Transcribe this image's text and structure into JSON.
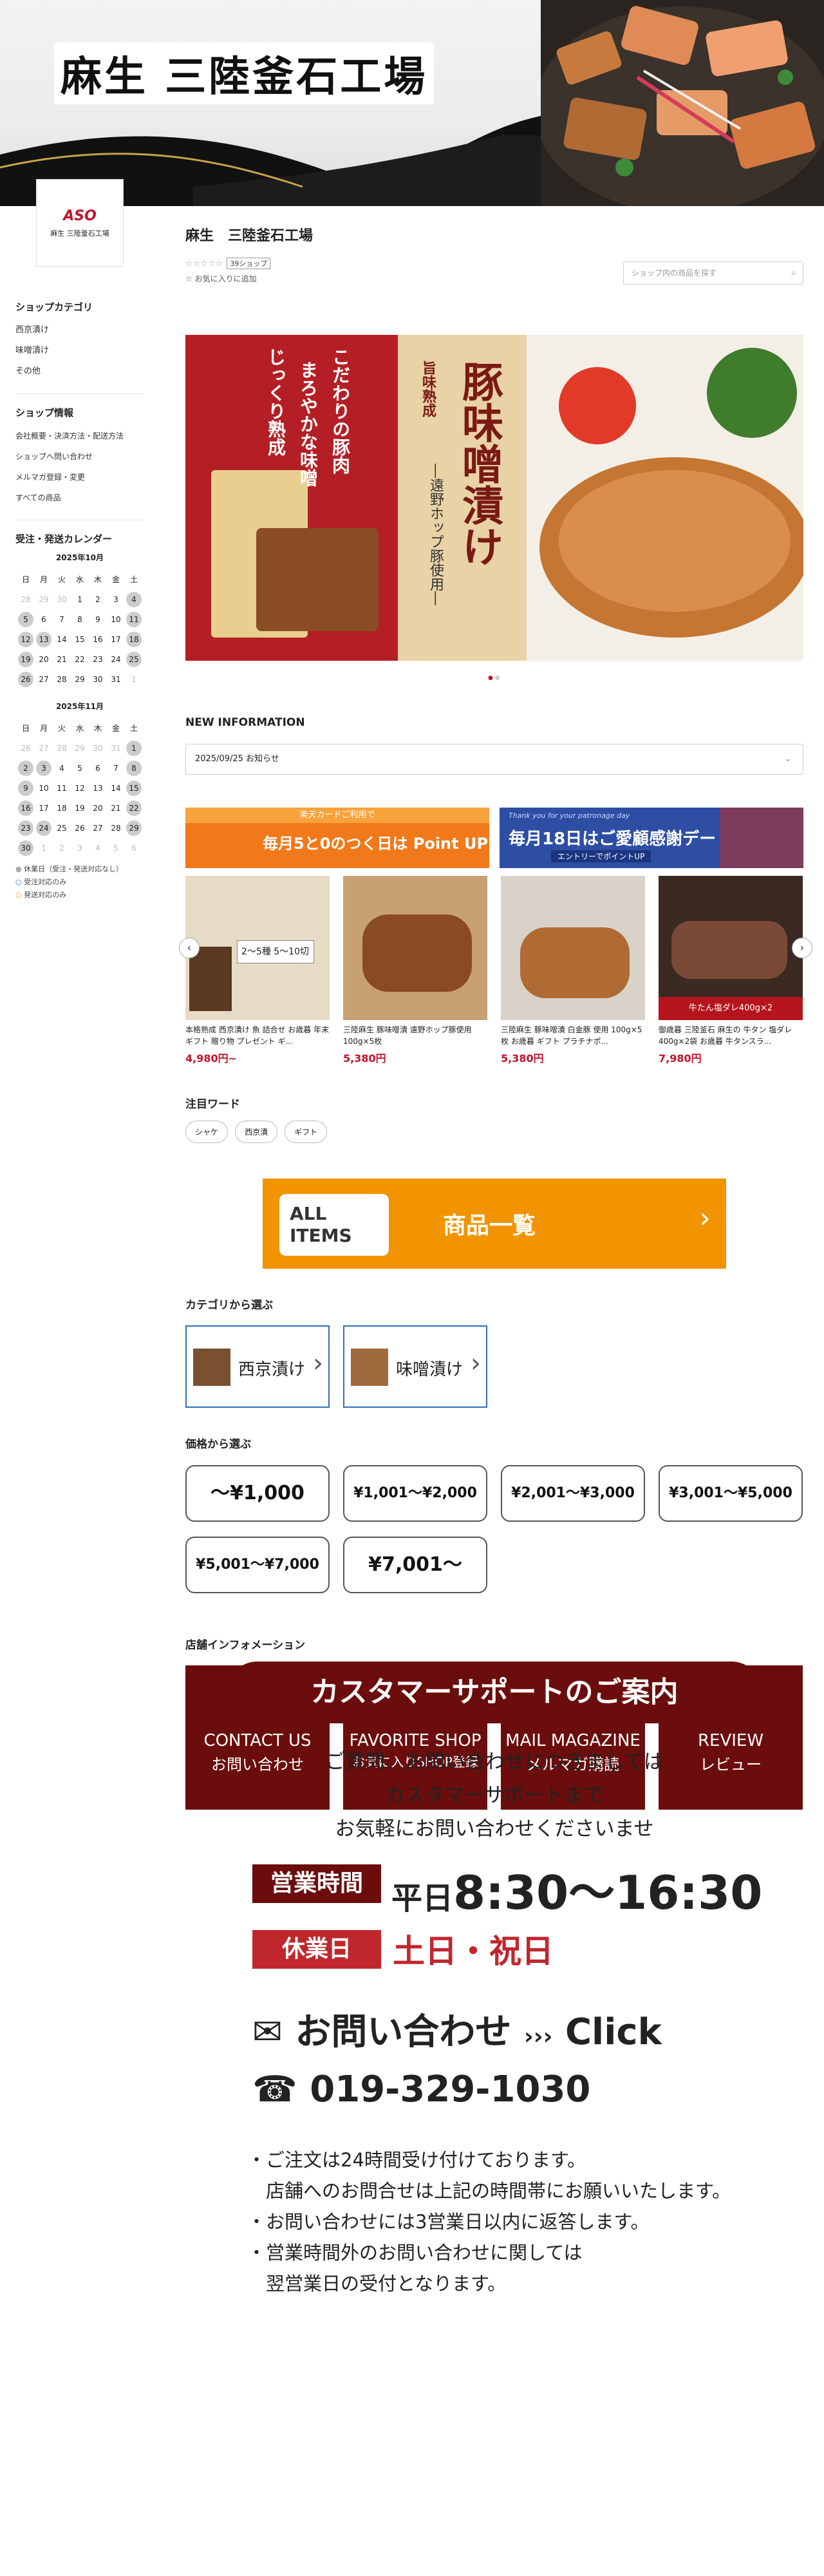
{
  "header": {
    "shop_title": "麻生 三陸釜石工場"
  },
  "logo": {
    "mark": "ASO",
    "name": "麻生 三陸釜石工場"
  },
  "sidebar": {
    "category_title": "ショップカテゴリ",
    "categories": [
      "西京漬け",
      "味噌漬け",
      "その他"
    ],
    "info_title": "ショップ情報",
    "info_links": [
      "会社概要・決済方法・配送方法",
      "ショップへ問い合わせ",
      "メルマガ登録・変更",
      "すべての商品"
    ],
    "calendar_title": "受注・発送カレンダー",
    "weekdays": [
      "日",
      "月",
      "火",
      "水",
      "木",
      "金",
      "土"
    ],
    "month1": "2025年10月",
    "month2": "2025年11月",
    "legend": [
      "休業日（受注・発送対応なし）",
      "受注対応のみ",
      "発送対応のみ"
    ]
  },
  "shop": {
    "name": "麻生　三陸釜石工場",
    "review_count": "39ショップ",
    "favorite": "お気に入りに追加",
    "search_placeholder": "ショップ内の商品を探す"
  },
  "banner": {
    "main": "豚味噌漬け",
    "sub": "旨味熟成",
    "tag": "―遠野ホップ豚使用―",
    "left1": "こだわりの豚肉",
    "left2": "まろやかな味噌",
    "left3": "じっくり熟成"
  },
  "news": {
    "title": "NEW INFORMATION",
    "item": "2025/09/25 お知らせ"
  },
  "promos": [
    {
      "top": "楽天カードご利用で",
      "main": "毎月5と0のつく日は Point UP"
    },
    {
      "top": "Thank you for your patronage day",
      "main": "毎月18日はご愛顧感謝デー",
      "sub": "エントリーでポイントUP"
    }
  ],
  "products": [
    {
      "title": "本格熟成 西京漬け 魚 詰合せ お歳暮 年末ギフト 贈り物 プレゼント ギ...",
      "price": "4,980円~",
      "badge": "2〜5種 5〜10切"
    },
    {
      "title": "三陸麻生 豚味噌漬 遠野ホップ豚使用 100g×5枚",
      "price": "5,380円"
    },
    {
      "title": "三陸麻生 豚味噌漬 白金豚 使用 100g×5枚 お歳暮 ギフト プラチナポ...",
      "price": "5,380円"
    },
    {
      "title": "御歳暮 三陸釜石 麻生の 牛タン 塩ダレ 400g×2袋 お歳暮 牛タンスラ...",
      "price": "7,980円",
      "badge": "牛たん塩ダレ400g×2"
    }
  ],
  "keywords": {
    "title": "注目ワード",
    "tags": [
      "シャケ",
      "西京漬",
      "ギフト"
    ]
  },
  "all_items": {
    "en1": "ALL",
    "en2": "ITEMS",
    "jp": "商品一覧"
  },
  "category_section": {
    "title": "カテゴリから選ぶ",
    "items": [
      "西京漬け",
      "味噌漬け"
    ]
  },
  "price_section": {
    "title": "価格から選ぶ",
    "items": [
      "〜¥1,000",
      "¥1,001〜¥2,000",
      "¥2,001〜¥3,000",
      "¥3,001〜¥5,000",
      "¥5,001〜¥7,000",
      "¥7,001〜"
    ]
  },
  "info_section": {
    "title": "店舗インフォメーション",
    "items": [
      {
        "en": "CONTACT US",
        "jp": "お問い合わせ",
        "icon": "chat-icon"
      },
      {
        "en": "FAVORITE SHOP",
        "jp": "お気に入りSHOP登録",
        "icon": "home-icon"
      },
      {
        "en": "MAIL MAGAZINE",
        "jp": "メルマガ購読",
        "icon": "mail-icon"
      },
      {
        "en": "REVIEW",
        "jp": "レビュー",
        "icon": "review-icon"
      }
    ]
  },
  "support": {
    "title": "カスタマーサポートのご案内",
    "line1": "ご質問、お問い合わせにつきましては",
    "line2": "カスタマーサポートまで",
    "line3": "お気軽にお問い合わせくださいませ",
    "hours_label": "営業時間",
    "hours_day": "平日",
    "hours_value": "8:30〜16:30",
    "off_label": "休業日",
    "off_value": "土日・祝日",
    "contact": "お問い合わせ",
    "click": "Click",
    "phone": "019-329-1030",
    "notes": [
      "・ご注文は24時間受け付けております。",
      "　店舗へのお問合せは上記の時間帯にお願いいたします。",
      "・お問い合わせには3営業日以内に返答します。",
      "・営業時間外のお問い合わせに関しては",
      "　翌営業日の受付となります。"
    ]
  },
  "colors": {
    "maroon": "#6b0d0d",
    "red": "#c0272d",
    "orange": "#f29400",
    "blue": "#2f6fb7"
  }
}
